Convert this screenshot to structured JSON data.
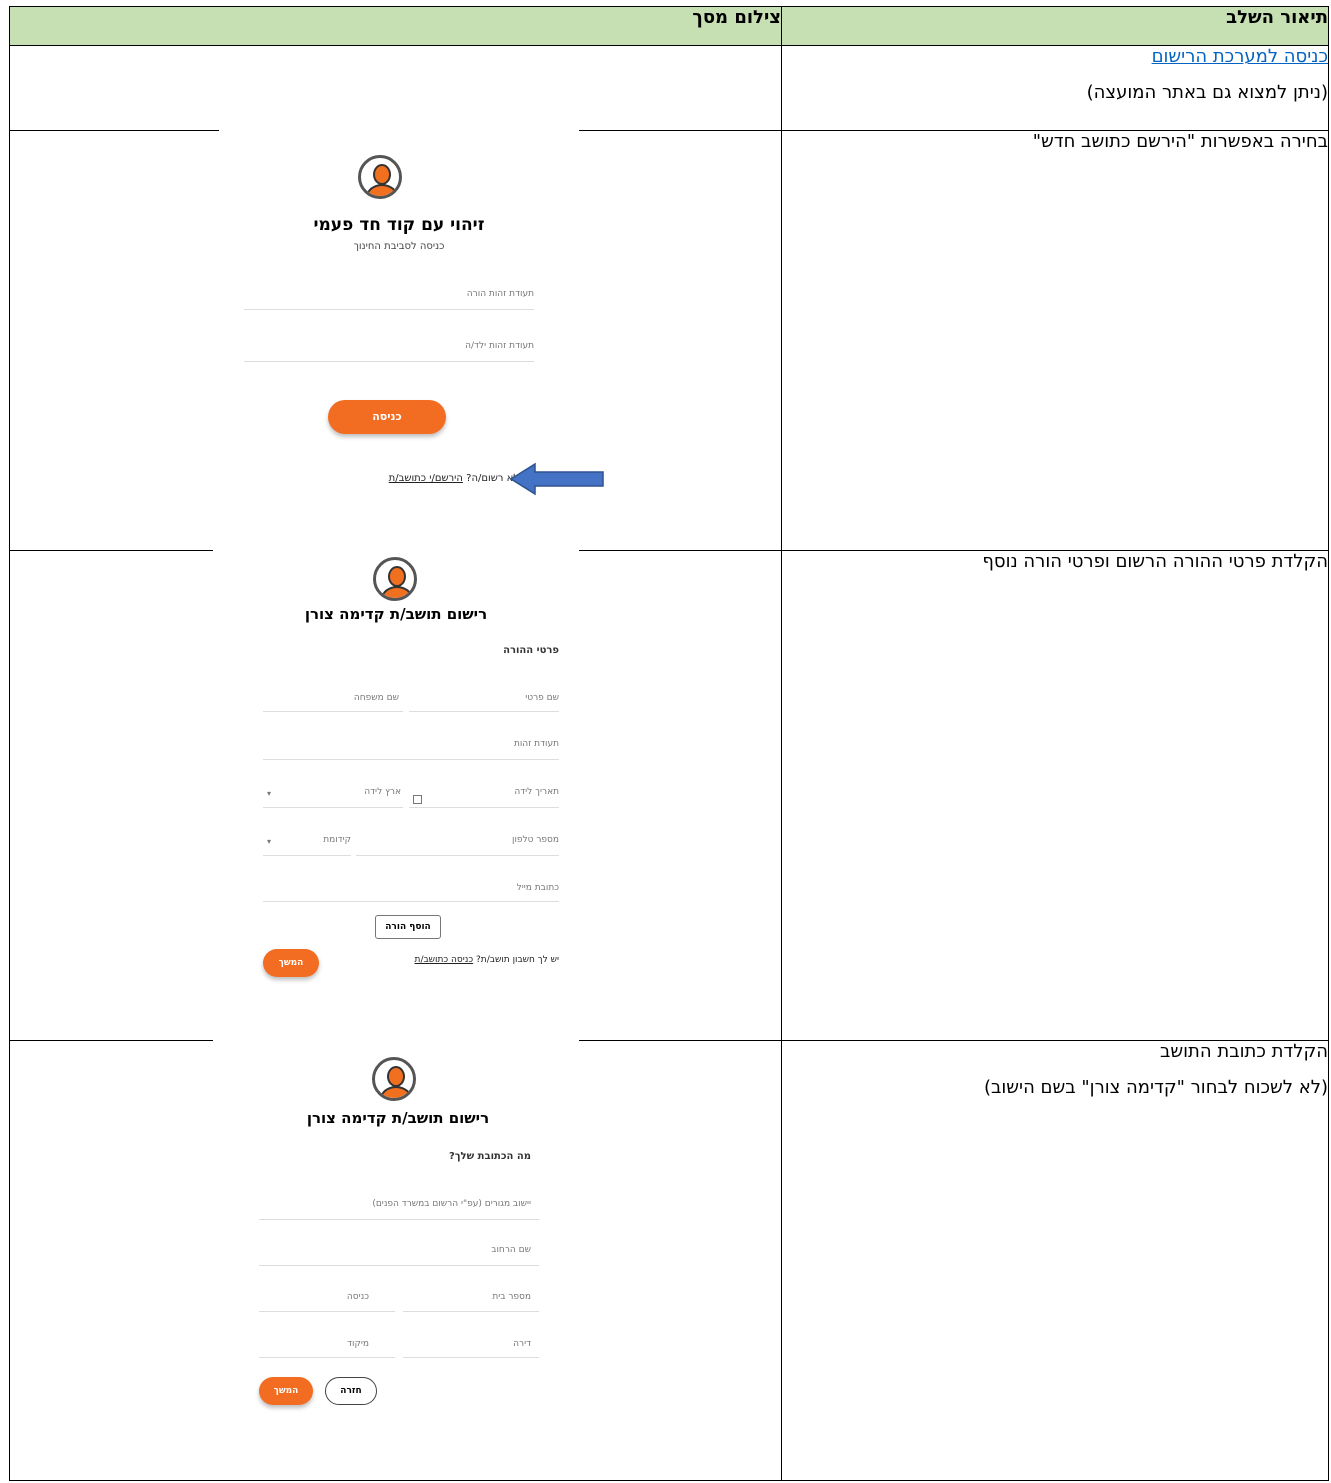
{
  "table": {
    "header_step": "תיאור השלב",
    "header_screenshot": "צילום מסך"
  },
  "rows": [
    {
      "link": "כניסה למערכת הרישום",
      "note": "(ניתן למצוא גם באתר המועצה)"
    },
    {
      "desc": "בחירה באפשרות \"הירשם כתושב חדש\"",
      "shot": {
        "title": "זיהוי עם קוד חד פעמי",
        "subtitle": "כניסה לסביבת החינוך",
        "field1": "תעודת זהות הורה",
        "field2": "תעודת זהות ילד/ה",
        "button": "כניסה",
        "footer_text": "לא רשום/ה?",
        "footer_link": "הירשם/י כתושב/ת"
      }
    },
    {
      "desc": "הקלדת פרטי ההורה הרשום ופרטי הורה נוסף",
      "shot": {
        "title": "רישום תושב/ת קדימה צורן",
        "section": "פרטי ההורה",
        "first_name": "שם פרטי",
        "last_name": "שם משפחה",
        "id": "תעודת זהות",
        "birth_date": "תאריך לידה",
        "birth_country": "ארץ לידה",
        "phone": "מספר טלפון",
        "prefix": "קידומת",
        "email": "כתובת מייל",
        "add_parent": "הוסף הורה",
        "has_account": "יש לך חשבון תושב/ת?",
        "login_link": "כניסה כתושב/ת",
        "continue": "המשך"
      }
    },
    {
      "desc": "הקלדת כתובת התושב",
      "note": "(לא לשכוח לבחור \"קדימה צורן\" בשם הישוב)",
      "shot": {
        "title": "רישום תושב/ת קדימה צורן",
        "section": "מה הכתובת שלך?",
        "settlement": "יישוב מגורים (עפ\"י הרשום במשרד הפנים)",
        "street": "שם הרחוב",
        "house": "מספר בית",
        "entrance": "כניסה",
        "apartment": "דירה",
        "zip": "מיקוד",
        "back": "חזרה",
        "continue": "המשך"
      }
    }
  ],
  "colors": {
    "header_bg": "#c6e0b4",
    "orange": "#f26c21",
    "arrow": "#4472c4",
    "link": "#0563c1"
  }
}
